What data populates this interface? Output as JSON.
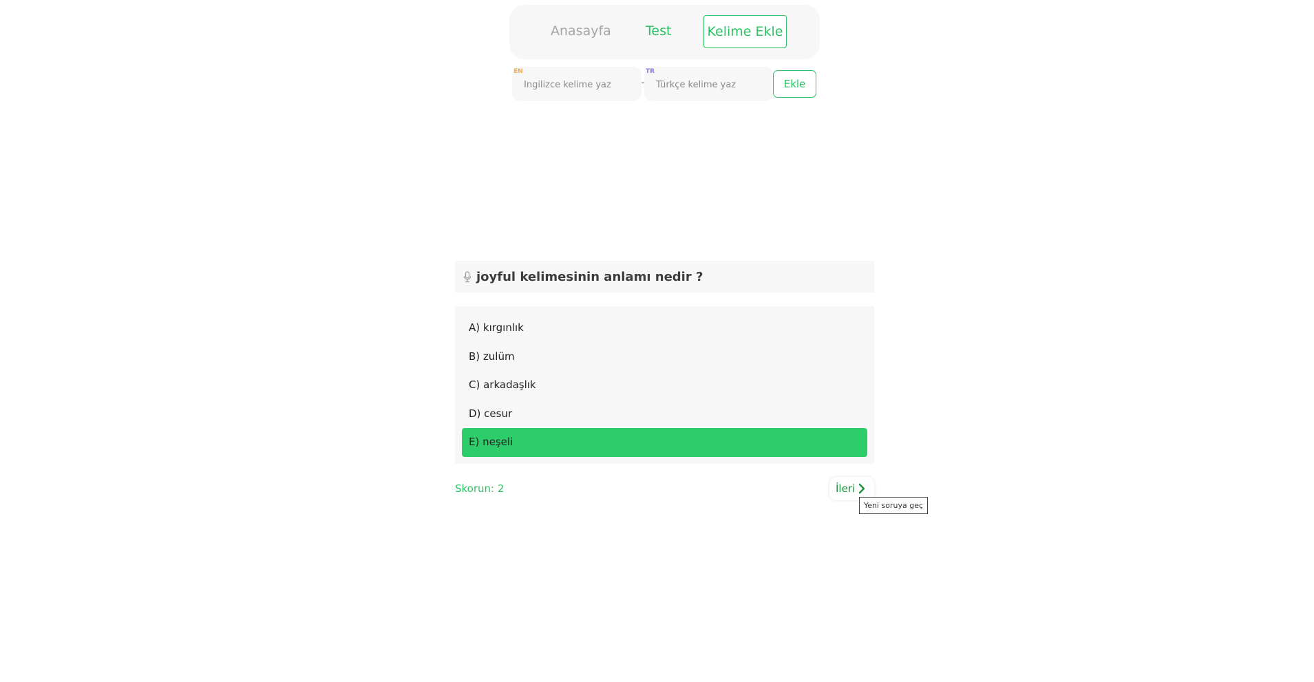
{
  "nav": {
    "items": [
      {
        "label": "Anasayfa"
      },
      {
        "label": "Test"
      },
      {
        "label": "Kelime Ekle",
        "active": true
      }
    ]
  },
  "form": {
    "en_tag": "EN",
    "en_placeholder": "İngilizce kelime yaz",
    "separator": "-",
    "tr_tag": "TR",
    "tr_placeholder": "Türkçe kelime yaz",
    "add_label": "Ekle"
  },
  "quiz": {
    "question_icon": "microphone-icon",
    "question": "joyful kelimesinin anlamı nedir ?",
    "options": [
      {
        "label": "A) kırgınlık",
        "selected": false
      },
      {
        "label": "B) zulüm",
        "selected": false
      },
      {
        "label": "C) arkadaşlık",
        "selected": false
      },
      {
        "label": "D) cesur",
        "selected": false
      },
      {
        "label": "E) neşeli",
        "selected": true
      }
    ],
    "score_label": "Skorun: 2",
    "next_label": "İleri",
    "next_icon": "chevron-right-icon",
    "next_tooltip": "Yeni soruya geç"
  },
  "colors": {
    "accent": "#2dc364",
    "selected_option": "#2dcd6a",
    "panel_bg": "#f7f7f7",
    "en_tag": "#f0ad4e",
    "tr_tag": "#8c7ae6"
  }
}
